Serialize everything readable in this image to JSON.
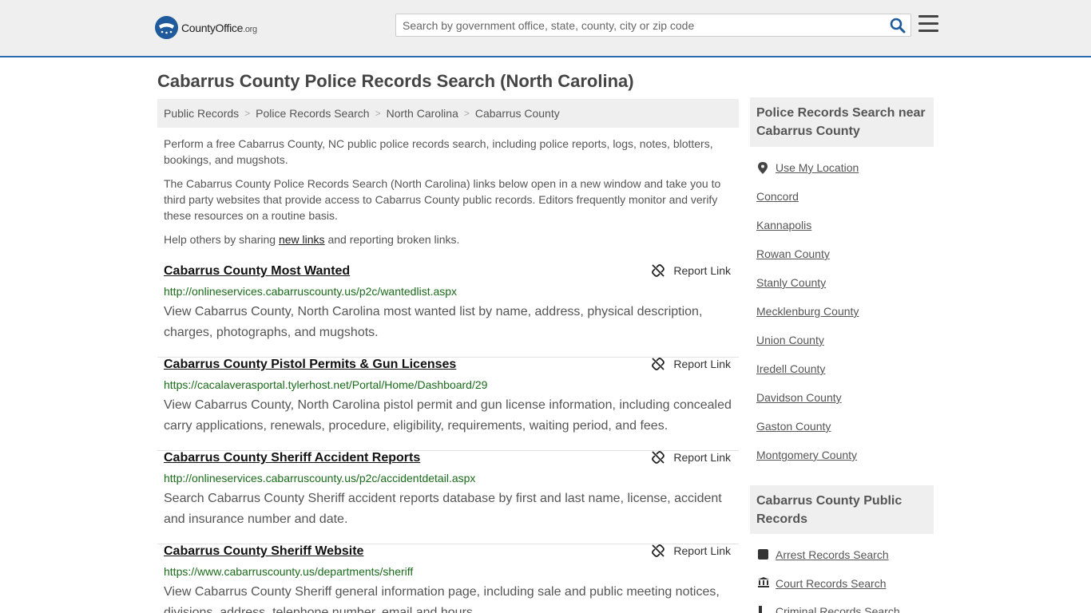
{
  "header": {
    "logo_text": "CountyOffice",
    "logo_suffix": ".org",
    "search_placeholder": "Search by government office, state, county, city or zip code"
  },
  "page_title": "Cabarrus County Police Records Search (North Carolina)",
  "breadcrumb": [
    "Public Records",
    "Police Records Search",
    "North Carolina",
    "Cabarrus County"
  ],
  "intro": {
    "p1": "Perform a free Cabarrus County, NC public police records search, including police reports, logs, notes, blotters, bookings, and mugshots.",
    "p2": "The Cabarrus County Police Records Search (North Carolina) links below open in a new window and take you to third party websites that provide access to Cabarrus County public records. Editors frequently monitor and verify these resources on a routine basis.",
    "p3_before": "Help others by sharing ",
    "p3_link": "new links",
    "p3_after": " and reporting broken links."
  },
  "report_label": "Report Link",
  "results": [
    {
      "title": "Cabarrus County Most Wanted",
      "url": "http://onlineservices.cabarruscounty.us/p2c/wantedlist.aspx",
      "desc": "View Cabarrus County, North Carolina most wanted list by name, address, physical description, charges, photographs, and mugshots."
    },
    {
      "title": "Cabarrus County Pistol Permits & Gun Licenses",
      "url": "https://cacalaverasportal.tylerhost.net/Portal/Home/Dashboard/29",
      "desc": "View Cabarrus County, North Carolina pistol permit and gun license information, including concealed carry applications, renewals, procedure, eligibility, requirements, waiting period, and fees."
    },
    {
      "title": "Cabarrus County Sheriff Accident Reports",
      "url": "http://onlineservices.cabarruscounty.us/p2c/accidentdetail.aspx",
      "desc": "Search Cabarrus County Sheriff accident reports database by first and last name, license, accident and insurance number and date."
    },
    {
      "title": "Cabarrus County Sheriff Website",
      "url": "https://www.cabarruscounty.us/departments/sheriff",
      "desc": "View Cabarrus County Sheriff general information page, including sale and public meeting notices, divisions, address, telephone number, email and hours."
    }
  ],
  "sidebar": {
    "nearby_title": "Police Records Search near Cabarrus County",
    "use_location": "Use My Location",
    "nearby": [
      "Concord",
      "Kannapolis",
      "Rowan County",
      "Stanly County",
      "Mecklenburg County",
      "Union County",
      "Iredell County",
      "Davidson County",
      "Gaston County",
      "Montgomery County"
    ],
    "public_title": "Cabarrus County Public Records",
    "public_links": [
      "Arrest Records Search",
      "Court Records Search",
      "Criminal Records Search"
    ]
  }
}
